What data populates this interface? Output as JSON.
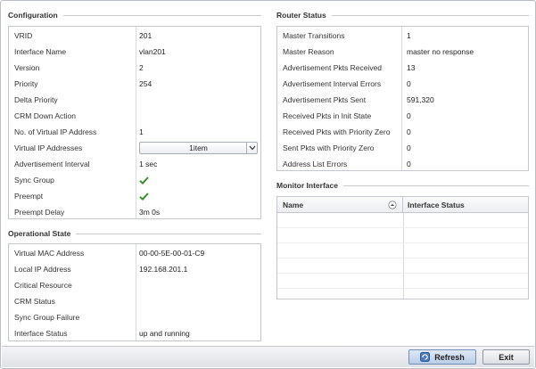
{
  "configuration": {
    "title": "Configuration",
    "rows": [
      {
        "label": "VRID",
        "value": "201"
      },
      {
        "label": "Interface Name",
        "value": "vlan201"
      },
      {
        "label": "Version",
        "value": "2"
      },
      {
        "label": "Priority",
        "value": "254"
      },
      {
        "label": "Delta Priority",
        "value": ""
      },
      {
        "label": "CRM Down Action",
        "value": ""
      },
      {
        "label": "No. of Virtual IP Address",
        "value": "1"
      },
      {
        "label": "Virtual IP Addresses",
        "value": "1item"
      },
      {
        "label": "Advertisement Interval",
        "value": "1 sec"
      },
      {
        "label": "Sync Group",
        "value": "check"
      },
      {
        "label": "Preempt",
        "value": "check"
      },
      {
        "label": "Preempt Delay",
        "value": "3m 0s"
      }
    ]
  },
  "operational_state": {
    "title": "Operational State",
    "rows": [
      {
        "label": "Virtual MAC Address",
        "value": "00-00-5E-00-01-C9"
      },
      {
        "label": "Local IP Address",
        "value": "192.168.201.1"
      },
      {
        "label": "Critical Resource",
        "value": ""
      },
      {
        "label": "CRM Status",
        "value": ""
      },
      {
        "label": "Sync Group Failure",
        "value": ""
      },
      {
        "label": "Interface Status",
        "value": "up and running"
      }
    ]
  },
  "router_status": {
    "title": "Router Status",
    "rows": [
      {
        "label": "Master Transitions",
        "value": "1"
      },
      {
        "label": "Master Reason",
        "value": "master no response"
      },
      {
        "label": "Advertisement Pkts Received",
        "value": "13"
      },
      {
        "label": "Advertisement Interval Errors",
        "value": "0"
      },
      {
        "label": "Advertisement Pkts Sent",
        "value": "591,320"
      },
      {
        "label": "Received Pkts in Init State",
        "value": "0"
      },
      {
        "label": "Received Pkts with Priority Zero",
        "value": "0"
      },
      {
        "label": "Sent Pkts with Priority Zero",
        "value": "0"
      },
      {
        "label": "Address List Errors",
        "value": "0"
      }
    ]
  },
  "monitor_interface": {
    "title": "Monitor Interface",
    "columns": [
      "Name",
      "Interface Status"
    ]
  },
  "footer": {
    "refresh_label": "Refresh",
    "exit_label": "Exit"
  },
  "colors": {
    "check": "#3a8f2c",
    "accent": "#6f8fb8"
  }
}
